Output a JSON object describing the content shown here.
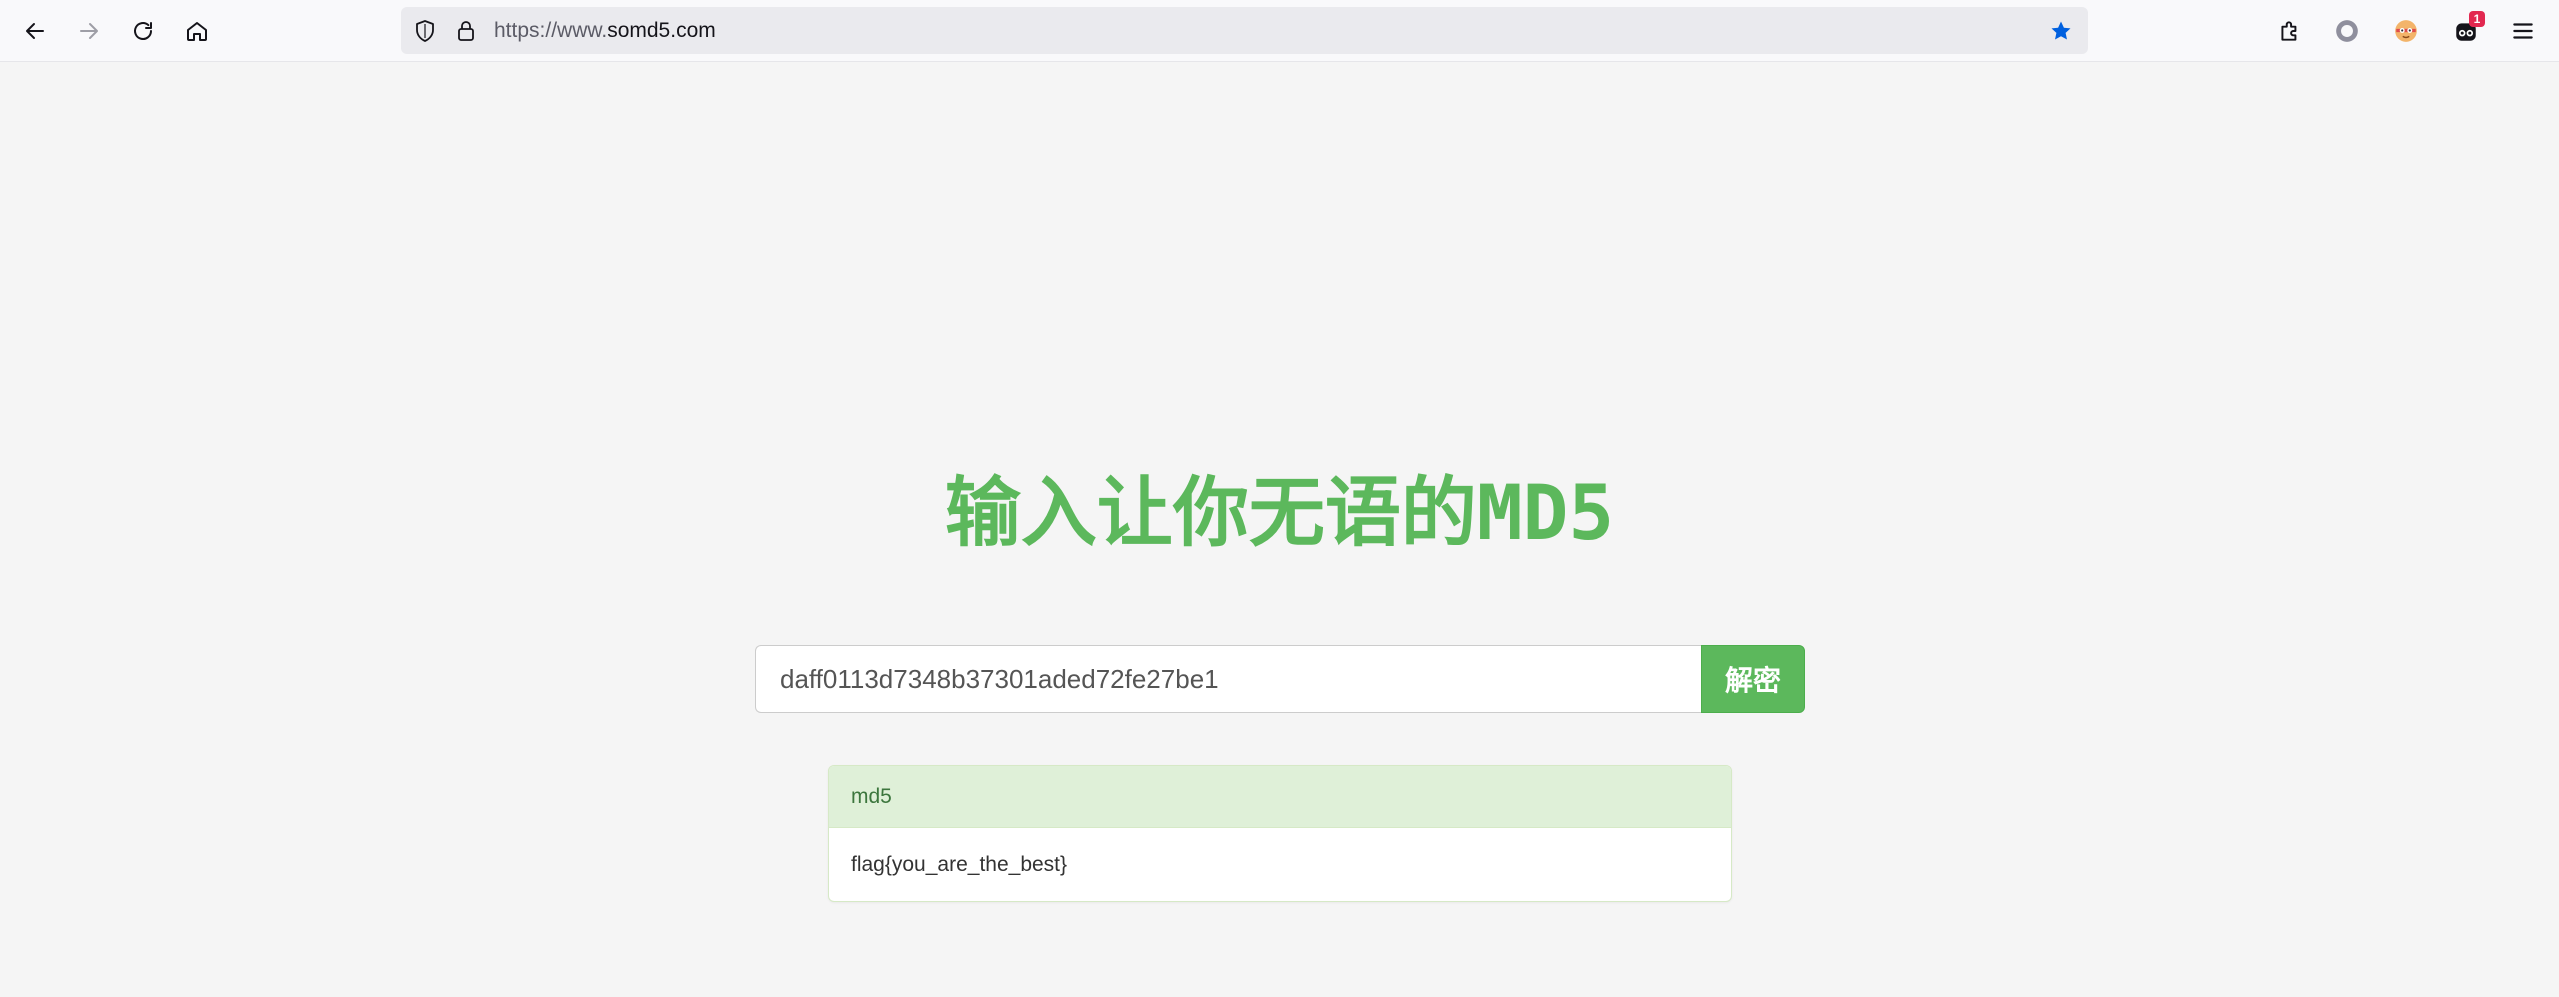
{
  "browser": {
    "url_prefix": "https://www.",
    "url_host": "somd5.com",
    "notification_count": "1",
    "icons": {
      "back": "arrow-left-icon",
      "forward": "arrow-right-icon",
      "reload": "reload-icon",
      "home": "home-icon",
      "shield": "shield-icon",
      "lock": "lock-icon",
      "bookmark": "star-icon",
      "extension": "puzzle-icon",
      "record": "circle-icon",
      "avatar": "avatar-icon",
      "extension2": "mask-icon",
      "menu": "hamburger-icon"
    },
    "accent_color": "#0060df"
  },
  "page": {
    "headline": "输入让你无语的MD5",
    "search_value": "daff0113d7348b37301aded72fe27be1",
    "decrypt_button": "解密",
    "result_type": "md5",
    "result_value": "flag{you_are_the_best}",
    "brand_color": "#5cb85c"
  }
}
